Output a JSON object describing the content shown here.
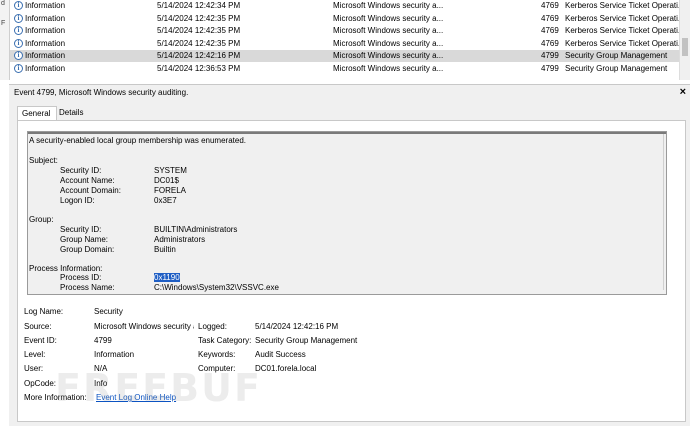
{
  "list": {
    "rows": [
      {
        "level": "Information",
        "date": "5/14/2024 12:42:34 PM",
        "source": "Microsoft Windows security a...",
        "id": "4769",
        "category": "Kerberos Service Ticket Operati..."
      },
      {
        "level": "Information",
        "date": "5/14/2024 12:42:35 PM",
        "source": "Microsoft Windows security a...",
        "id": "4769",
        "category": "Kerberos Service Ticket Operati..."
      },
      {
        "level": "Information",
        "date": "5/14/2024 12:42:35 PM",
        "source": "Microsoft Windows security a...",
        "id": "4769",
        "category": "Kerberos Service Ticket Operati..."
      },
      {
        "level": "Information",
        "date": "5/14/2024 12:42:35 PM",
        "source": "Microsoft Windows security a...",
        "id": "4769",
        "category": "Kerberos Service Ticket Operati..."
      },
      {
        "level": "Information",
        "date": "5/14/2024 12:42:16 PM",
        "source": "Microsoft Windows security a...",
        "id": "4799",
        "category": "Security Group Management",
        "selected": true
      },
      {
        "level": "Information",
        "date": "5/14/2024 12:36:53 PM",
        "source": "Microsoft Windows security a...",
        "id": "4799",
        "category": "Security Group Management"
      }
    ]
  },
  "detail": {
    "title": "Event 4799, Microsoft Windows security auditing.",
    "close": "×",
    "tabs": {
      "general": "General",
      "details": "Details"
    },
    "message": {
      "intro": "A security-enabled local group membership was enumerated.",
      "subject": {
        "header": "Subject:",
        "security_id_label": "Security ID:",
        "security_id": "SYSTEM",
        "account_name_label": "Account Name:",
        "account_name": "DC01$",
        "account_domain_label": "Account Domain:",
        "account_domain": "FORELA",
        "logon_id_label": "Logon ID:",
        "logon_id": "0x3E7"
      },
      "group": {
        "header": "Group:",
        "security_id_label": "Security ID:",
        "security_id": "BUILTIN\\Administrators",
        "group_name_label": "Group Name:",
        "group_name": "Administrators",
        "group_domain_label": "Group Domain:",
        "group_domain": "Builtin"
      },
      "process": {
        "header": "Process Information:",
        "process_id_label": "Process ID:",
        "process_id": "0x1190",
        "process_name_label": "Process Name:",
        "process_name": "C:\\Windows\\System32\\VSSVC.exe"
      }
    },
    "fields": {
      "log_name_label": "Log Name:",
      "log_name": "Security",
      "source_label": "Source:",
      "source": "Microsoft Windows security a",
      "logged_label": "Logged:",
      "logged": "5/14/2024 12:42:16 PM",
      "event_id_label": "Event ID:",
      "event_id": "4799",
      "task_category_label": "Task Category:",
      "task_category": "Security Group Management",
      "level_label": "Level:",
      "level": "Information",
      "keywords_label": "Keywords:",
      "keywords": "Audit Success",
      "user_label": "User:",
      "user": "N/A",
      "computer_label": "Computer:",
      "computer": "DC01.forela.local",
      "opcode_label": "OpCode:",
      "opcode": "Info",
      "more_info_label": "More Information:",
      "more_info_link": "Event Log Online Help"
    }
  },
  "watermark": "FREEBUF"
}
